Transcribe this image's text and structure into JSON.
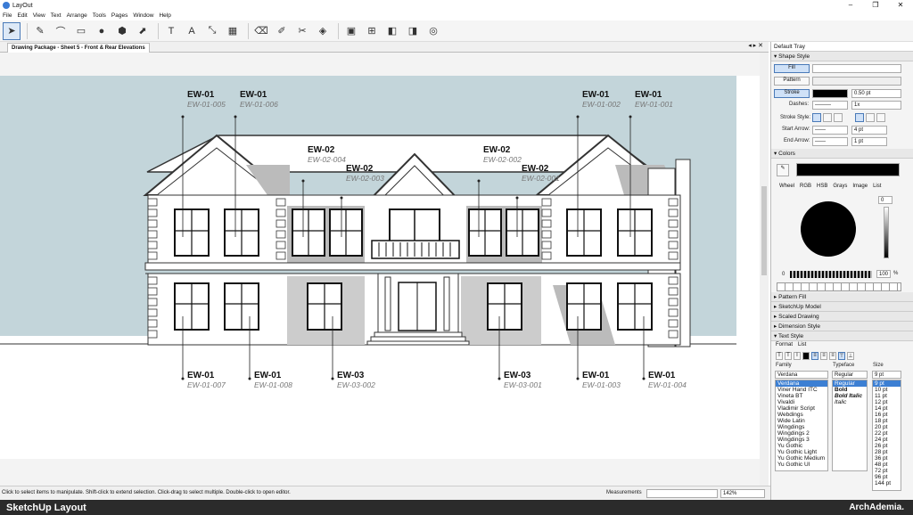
{
  "window": {
    "title": "LayOut",
    "minimize": "–",
    "maximize": "❐",
    "close": "✕"
  },
  "menu": [
    "File",
    "Edit",
    "View",
    "Text",
    "Arrange",
    "Tools",
    "Pages",
    "Window",
    "Help"
  ],
  "document": {
    "tab": "Drawing Package - Sheet 5 - Front & Rear Elevations",
    "controls": "◂ ▸ ✕"
  },
  "callouts": [
    {
      "code": "EW-01",
      "ref": "EW-01-005"
    },
    {
      "code": "EW-01",
      "ref": "EW-01-006"
    },
    {
      "code": "EW-02",
      "ref": "EW-02-004"
    },
    {
      "code": "EW-02",
      "ref": "EW-02-003"
    },
    {
      "code": "EW-02",
      "ref": "EW-02-002"
    },
    {
      "code": "EW-02",
      "ref": "EW-02-001"
    },
    {
      "code": "EW-01",
      "ref": "EW-01-002"
    },
    {
      "code": "EW-01",
      "ref": "EW-01-001"
    },
    {
      "code": "EW-01",
      "ref": "EW-01-007"
    },
    {
      "code": "EW-01",
      "ref": "EW-01-008"
    },
    {
      "code": "EW-03",
      "ref": "EW-03-002"
    },
    {
      "code": "EW-03",
      "ref": "EW-03-001"
    },
    {
      "code": "EW-01",
      "ref": "EW-01-003"
    },
    {
      "code": "EW-01",
      "ref": "EW-01-004"
    }
  ],
  "tray": {
    "title": "Default Tray",
    "shape_style": {
      "header": "Shape Style",
      "fill": "Fill",
      "pattern": "Pattern",
      "stroke": "Stroke",
      "stroke_width": "0.50 pt",
      "dashes_label": "Dashes:",
      "dashes_scale": "1x",
      "stroke_style_label": "Stroke Style:",
      "start_arrow_label": "Start Arrow:",
      "start_arrow_size": "4 pt",
      "end_arrow_label": "End Arrow:",
      "end_arrow_size": "1 pt"
    },
    "colors": {
      "header": "Colors",
      "tabs": [
        "Wheel",
        "RGB",
        "HSB",
        "Grays",
        "Image",
        "List"
      ],
      "brightness": "0",
      "opacity_min": "0",
      "opacity": "100",
      "pct": "%"
    },
    "collapsed": [
      "Pattern Fill",
      "SketchUp Model",
      "Scaled Drawing",
      "Dimension Style"
    ],
    "text_style": {
      "header": "Text Style",
      "tabs": [
        "Format",
        "List"
      ],
      "family_label": "Family",
      "typeface_label": "Typeface",
      "size_label": "Size",
      "family": "Verdana",
      "typeface": "Regular",
      "size": "9 pt",
      "families": [
        "Verdana",
        "Viner Hand ITC",
        "Vineta BT",
        "Vivaldi",
        "Vladimir Script",
        "Webdings",
        "Wide Latin",
        "Wingdings",
        "Wingdings 2",
        "Wingdings 3",
        "Yu Gothic",
        "Yu Gothic Light",
        "Yu Gothic Medium",
        "Yu Gothic UI"
      ],
      "typefaces": [
        "Regular",
        "Bold",
        "Bold Italic",
        "Italic"
      ],
      "sizes": [
        "9 pt",
        "10 pt",
        "11 pt",
        "12 pt",
        "14 pt",
        "16 pt",
        "18 pt",
        "20 pt",
        "22 pt",
        "24 pt",
        "26 pt",
        "28 pt",
        "36 pt",
        "48 pt",
        "72 pt",
        "96 pt",
        "144 pt"
      ]
    }
  },
  "status": {
    "message": "Click to select items to manipulate. Shift-click to extend selection. Click-drag to select multiple. Double-click to open editor.",
    "measurements_label": "Measurements",
    "zoom": "142%"
  },
  "caption": {
    "left": "SketchUp Layout",
    "right": "ArchAdemia."
  },
  "colors": {
    "sky": "#c3d5da",
    "accent": "#3c7fd3"
  }
}
